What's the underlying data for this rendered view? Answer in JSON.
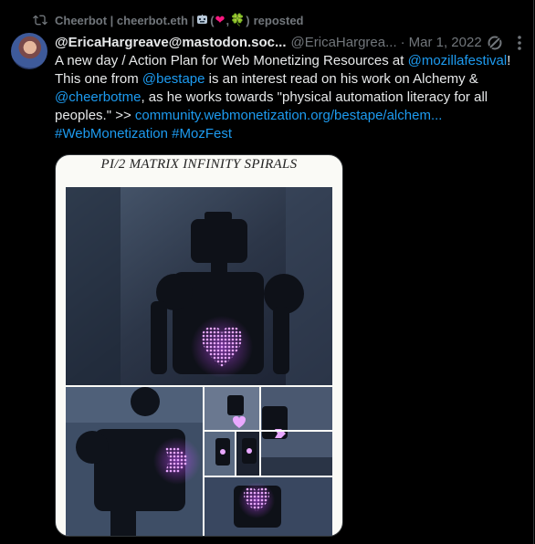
{
  "repost": {
    "user": "Cheerbot | cheerbot.eth |",
    "paren_open": "(",
    "heart": "❤",
    "sep": ",",
    "clover": "🍀",
    "paren_close": ")",
    "suffix": "reposted"
  },
  "post": {
    "display_name": "@EricaHargreave@mastodon.soc...",
    "handle": "@EricaHargrea...",
    "separator": "·",
    "date": "Mar 1, 2022",
    "body": {
      "t1": "A new day / Action Plan for Web Monetizing Resources at ",
      "m1": "@mozillafestival",
      "t2": "! This one from ",
      "m2": "@bestape",
      "t3": " is an interest read on his work on Alchemy & ",
      "m3": "@cheerbotme",
      "t4": ", as he works towards \"physical automation literacy for all peoples.\" >> ",
      "url": "community.webmonetization.org/bestape/alchem...",
      "h1": "#WebMonetization",
      "h2": "#MozFest"
    },
    "media": {
      "title": "PI/2 MATRIX INFINITY SPIRALS"
    }
  },
  "icons": {
    "repost": "repost-icon",
    "fediverse": "fediverse-icon",
    "more": "more-icon",
    "robot": "robot-emoji-icon"
  },
  "colors": {
    "background": "#000000",
    "text": "#e7e9ea",
    "muted": "#71767b",
    "link": "#1d9bf0",
    "heart": "#f91880",
    "glow": "#c44cff"
  }
}
